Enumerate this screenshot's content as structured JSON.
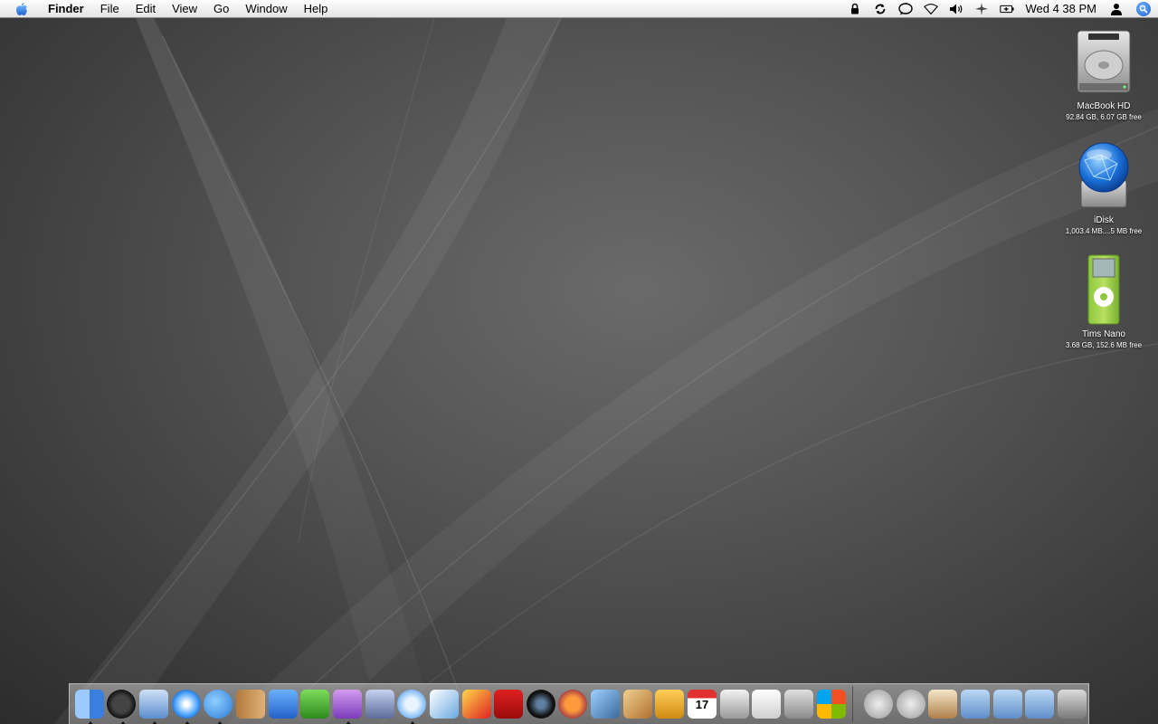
{
  "menubar": {
    "app_menu": "Finder",
    "menus": [
      "File",
      "Edit",
      "View",
      "Go",
      "Window",
      "Help"
    ],
    "clock": "Wed 4 38 PM"
  },
  "desktop_icons": [
    {
      "name": "MacBook HD",
      "info": "92.84 GB, 6.07 GB free",
      "icon": "hard-drive-icon"
    },
    {
      "name": "iDisk",
      "info": "1,003.4 MB....5 MB free",
      "icon": "idisk-globe-icon"
    },
    {
      "name": "Tims Nano",
      "info": "3.68 GB, 152.6 MB free",
      "icon": "ipod-nano-icon"
    }
  ],
  "dock": {
    "apps": [
      {
        "icon": "finder-icon",
        "running": true
      },
      {
        "icon": "dashboard-icon",
        "running": true
      },
      {
        "icon": "mail-icon",
        "running": true
      },
      {
        "icon": "safari-icon",
        "running": true
      },
      {
        "icon": "ichat-icon",
        "running": true
      },
      {
        "icon": "address-book-icon",
        "running": false
      },
      {
        "icon": "word-icon",
        "running": false
      },
      {
        "icon": "excel-icon",
        "running": false
      },
      {
        "icon": "entourage-icon",
        "running": true
      },
      {
        "icon": "quill-icon",
        "running": false
      },
      {
        "icon": "itunes-icon",
        "running": true
      },
      {
        "icon": "feather-icon",
        "running": false
      },
      {
        "icon": "acrobat-icon",
        "running": false
      },
      {
        "icon": "adobe-reader-icon",
        "running": false
      },
      {
        "icon": "aperture-icon",
        "running": false
      },
      {
        "icon": "recorder-icon",
        "running": false
      },
      {
        "icon": "iphoto-icon",
        "running": false
      },
      {
        "icon": "keynote-icon",
        "running": false
      },
      {
        "icon": "delivery-truck-icon",
        "running": false
      },
      {
        "icon": "ical-icon",
        "running": false,
        "label": "17"
      },
      {
        "icon": "printer-icon",
        "running": false
      },
      {
        "icon": "textedit-icon",
        "running": false
      },
      {
        "icon": "calculator-icon",
        "running": false
      },
      {
        "icon": "windows-icon",
        "running": false
      }
    ],
    "stacks": [
      {
        "icon": "mail-stack-icon"
      },
      {
        "icon": "mail-stack-2-icon"
      },
      {
        "icon": "home-icon"
      },
      {
        "icon": "applications-folder-icon"
      },
      {
        "icon": "documents-folder-icon"
      },
      {
        "icon": "pictures-folder-icon"
      },
      {
        "icon": "trash-icon"
      }
    ]
  }
}
